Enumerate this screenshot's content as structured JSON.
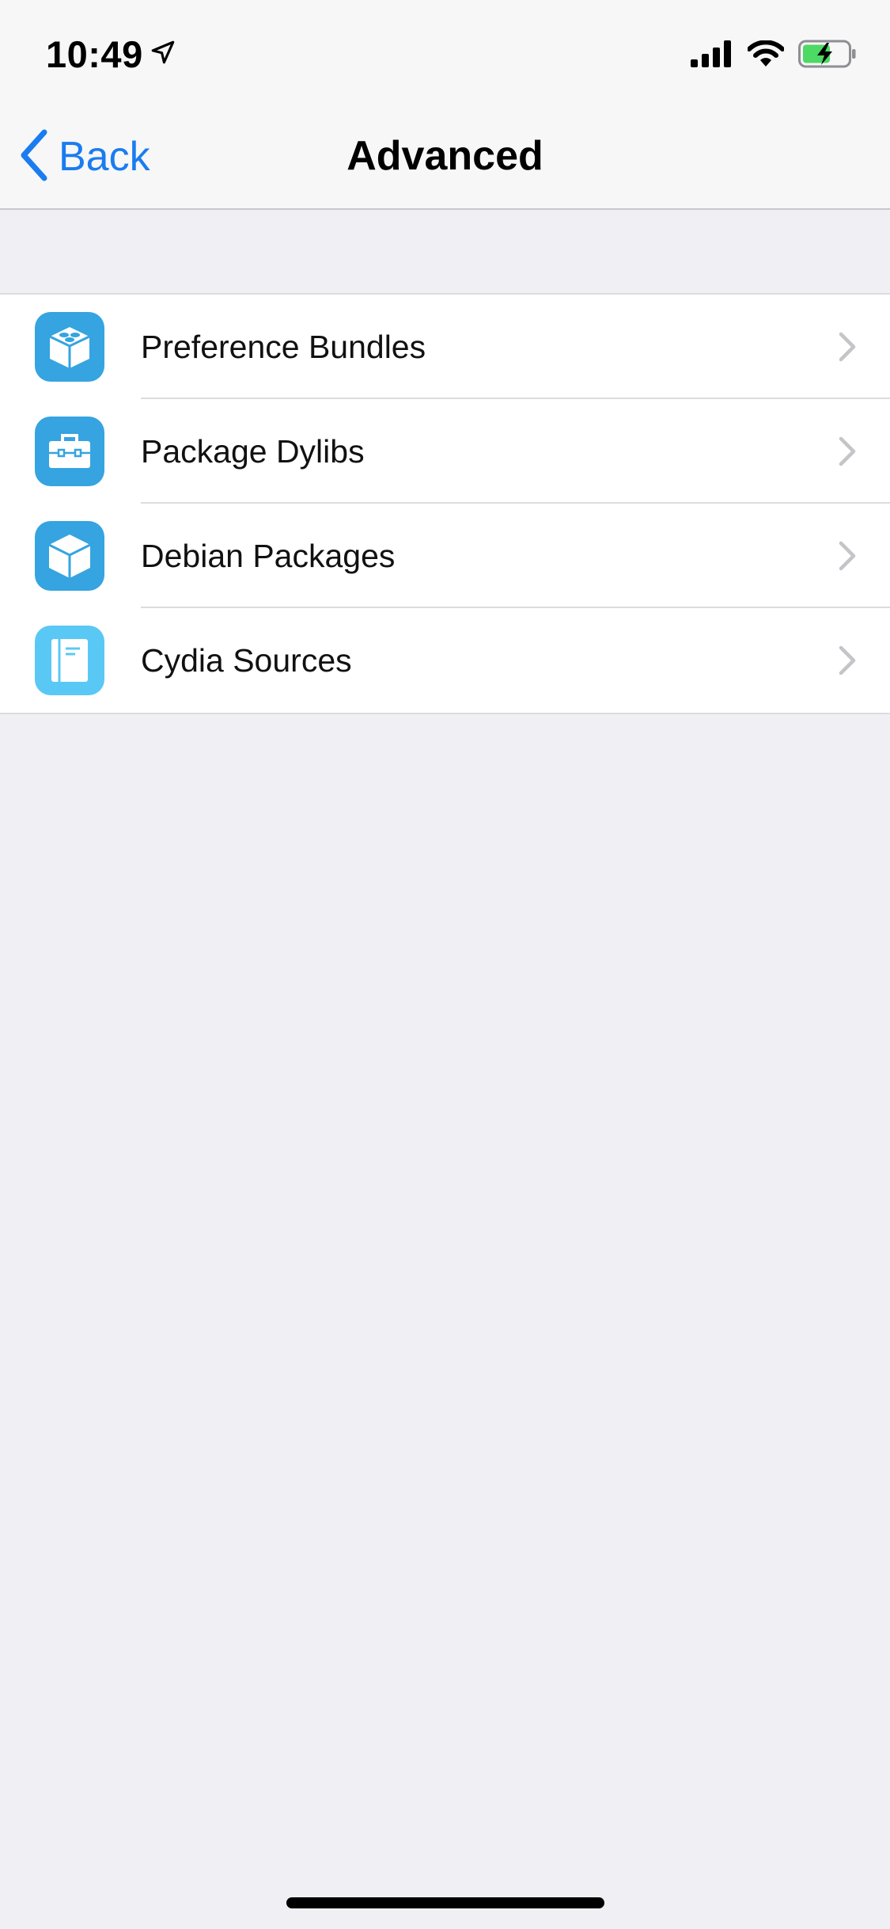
{
  "status_bar": {
    "time": "10:49",
    "location_icon": "location-arrow-icon",
    "signal_icon": "cellular-signal-icon",
    "wifi_icon": "wifi-icon",
    "battery_icon": "battery-charging-icon",
    "battery_color": "#4cd964"
  },
  "nav": {
    "back_label": "Back",
    "back_icon": "chevron-left-icon",
    "title": "Advanced",
    "accent": "#1a7cf0"
  },
  "list": {
    "items": [
      {
        "label": "Preference Bundles",
        "icon": "lego-brick-icon"
      },
      {
        "label": "Package Dylibs",
        "icon": "toolbox-icon"
      },
      {
        "label": "Debian Packages",
        "icon": "cube-box-icon"
      },
      {
        "label": "Cydia Sources",
        "icon": "notebook-icon"
      }
    ],
    "icon_color": "#35a4e0"
  }
}
